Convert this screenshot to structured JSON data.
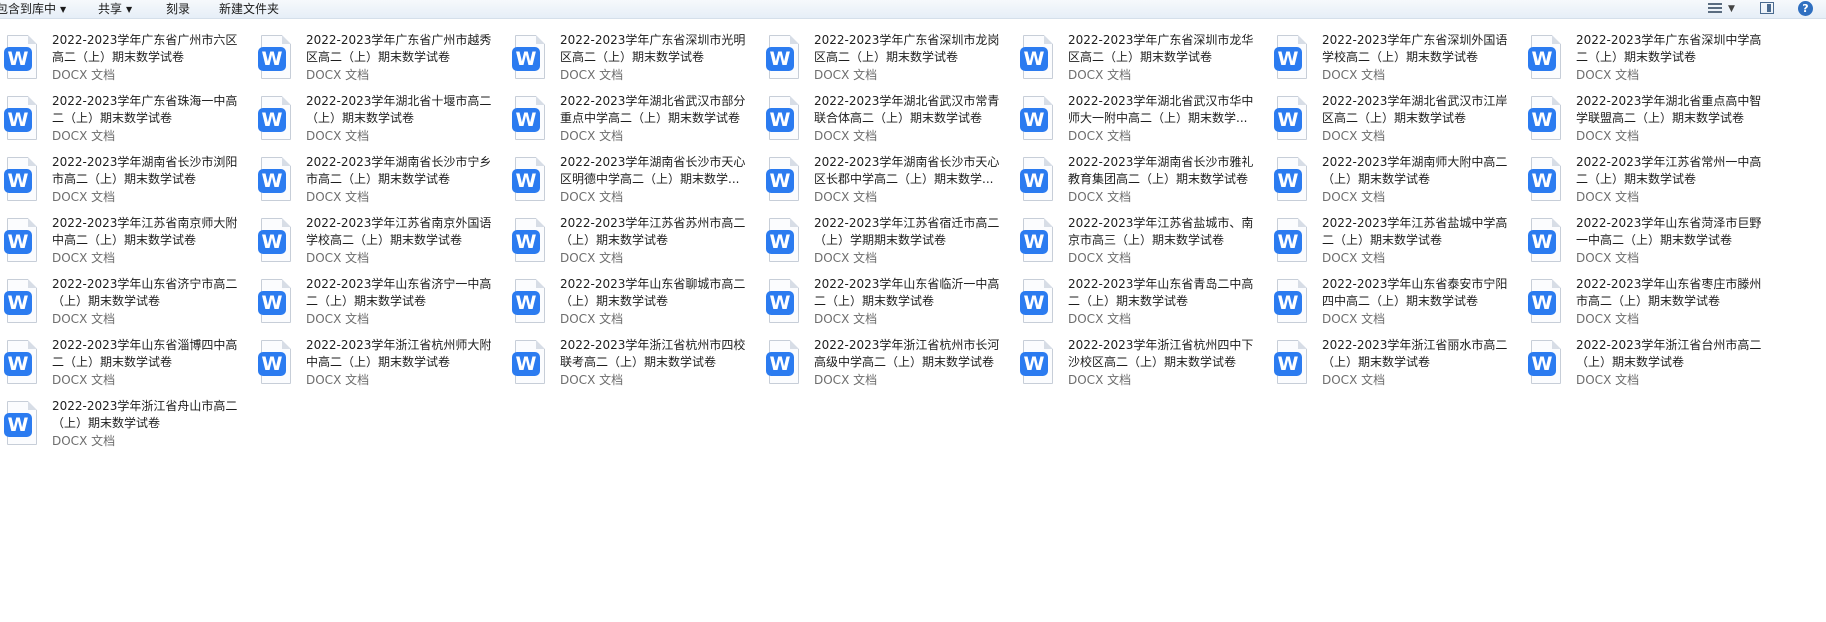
{
  "toolbar": {
    "items": [
      "包含到库中",
      "共享",
      "刻录",
      "新建文件夹"
    ]
  },
  "icons": {
    "file_badge_letter": "W",
    "badge_color": "#2b7bf0"
  },
  "files": [
    {
      "name": "2022-2023学年广东省广州市六区高二（上）期末数学试卷",
      "type": "DOCX 文档"
    },
    {
      "name": "2022-2023学年广东省广州市越秀区高二（上）期末数学试卷",
      "type": "DOCX 文档"
    },
    {
      "name": "2022-2023学年广东省深圳市光明区高二（上）期末数学试卷",
      "type": "DOCX 文档"
    },
    {
      "name": "2022-2023学年广东省深圳市龙岗区高二（上）期末数学试卷",
      "type": "DOCX 文档"
    },
    {
      "name": "2022-2023学年广东省深圳市龙华区高二（上）期末数学试卷",
      "type": "DOCX 文档"
    },
    {
      "name": "2022-2023学年广东省深圳外国语学校高二（上）期末数学试卷",
      "type": "DOCX 文档"
    },
    {
      "name": "2022-2023学年广东省深圳中学高二（上）期末数学试卷",
      "type": "DOCX 文档"
    },
    {
      "name": "2022-2023学年广东省珠海一中高二（上）期末数学试卷",
      "type": "DOCX 文档"
    },
    {
      "name": "2022-2023学年湖北省十堰市高二（上）期末数学试卷",
      "type": "DOCX 文档"
    },
    {
      "name": "2022-2023学年湖北省武汉市部分重点中学高二（上）期末数学试卷",
      "type": "DOCX 文档"
    },
    {
      "name": "2022-2023学年湖北省武汉市常青联合体高二（上）期末数学试卷",
      "type": "DOCX 文档"
    },
    {
      "name": "2022-2023学年湖北省武汉市华中师大一附中高二（上）期末数学...",
      "type": "DOCX 文档"
    },
    {
      "name": "2022-2023学年湖北省武汉市江岸区高二（上）期末数学试卷",
      "type": "DOCX 文档"
    },
    {
      "name": "2022-2023学年湖北省重点高中智学联盟高二（上）期末数学试卷",
      "type": "DOCX 文档"
    },
    {
      "name": "2022-2023学年湖南省长沙市浏阳市高二（上）期末数学试卷",
      "type": "DOCX 文档"
    },
    {
      "name": "2022-2023学年湖南省长沙市宁乡市高二（上）期末数学试卷",
      "type": "DOCX 文档"
    },
    {
      "name": "2022-2023学年湖南省长沙市天心区明德中学高二（上）期末数学...",
      "type": "DOCX 文档"
    },
    {
      "name": "2022-2023学年湖南省长沙市天心区长郡中学高二（上）期末数学...",
      "type": "DOCX 文档"
    },
    {
      "name": "2022-2023学年湖南省长沙市雅礼教育集团高二（上）期末数学试卷",
      "type": "DOCX 文档"
    },
    {
      "name": "2022-2023学年湖南师大附中高二（上）期末数学试卷",
      "type": "DOCX 文档"
    },
    {
      "name": "2022-2023学年江苏省常州一中高二（上）期末数学试卷",
      "type": "DOCX 文档"
    },
    {
      "name": "2022-2023学年江苏省南京师大附中高二（上）期末数学试卷",
      "type": "DOCX 文档"
    },
    {
      "name": "2022-2023学年江苏省南京外国语学校高二（上）期末数学试卷",
      "type": "DOCX 文档"
    },
    {
      "name": "2022-2023学年江苏省苏州市高二（上）期末数学试卷",
      "type": "DOCX 文档"
    },
    {
      "name": "2022-2023学年江苏省宿迁市高二（上）学期期末数学试卷",
      "type": "DOCX 文档"
    },
    {
      "name": "2022-2023学年江苏省盐城市、南京市高三（上）期末数学试卷",
      "type": "DOCX 文档"
    },
    {
      "name": "2022-2023学年江苏省盐城中学高二（上）期末数学试卷",
      "type": "DOCX 文档"
    },
    {
      "name": "2022-2023学年山东省菏泽市巨野一中高二（上）期末数学试卷",
      "type": "DOCX 文档"
    },
    {
      "name": "2022-2023学年山东省济宁市高二（上）期末数学试卷",
      "type": "DOCX 文档"
    },
    {
      "name": "2022-2023学年山东省济宁一中高二（上）期末数学试卷",
      "type": "DOCX 文档"
    },
    {
      "name": "2022-2023学年山东省聊城市高二（上）期末数学试卷",
      "type": "DOCX 文档"
    },
    {
      "name": "2022-2023学年山东省临沂一中高二（上）期末数学试卷",
      "type": "DOCX 文档"
    },
    {
      "name": "2022-2023学年山东省青岛二中高二（上）期末数学试卷",
      "type": "DOCX 文档"
    },
    {
      "name": "2022-2023学年山东省泰安市宁阳四中高二（上）期末数学试卷",
      "type": "DOCX 文档"
    },
    {
      "name": "2022-2023学年山东省枣庄市滕州市高二（上）期末数学试卷",
      "type": "DOCX 文档"
    },
    {
      "name": "2022-2023学年山东省淄博四中高二（上）期末数学试卷",
      "type": "DOCX 文档"
    },
    {
      "name": "2022-2023学年浙江省杭州师大附中高二（上）期末数学试卷",
      "type": "DOCX 文档"
    },
    {
      "name": "2022-2023学年浙江省杭州市四校联考高二（上）期末数学试卷",
      "type": "DOCX 文档"
    },
    {
      "name": "2022-2023学年浙江省杭州市长河高级中学高二（上）期末数学试卷",
      "type": "DOCX 文档"
    },
    {
      "name": "2022-2023学年浙江省杭州四中下沙校区高二（上）期末数学试卷",
      "type": "DOCX 文档"
    },
    {
      "name": "2022-2023学年浙江省丽水市高二（上）期末数学试卷",
      "type": "DOCX 文档"
    },
    {
      "name": "2022-2023学年浙江省台州市高二（上）期末数学试卷",
      "type": "DOCX 文档"
    },
    {
      "name": "2022-2023学年浙江省舟山市高二（上）期末数学试卷",
      "type": "DOCX 文档"
    }
  ]
}
